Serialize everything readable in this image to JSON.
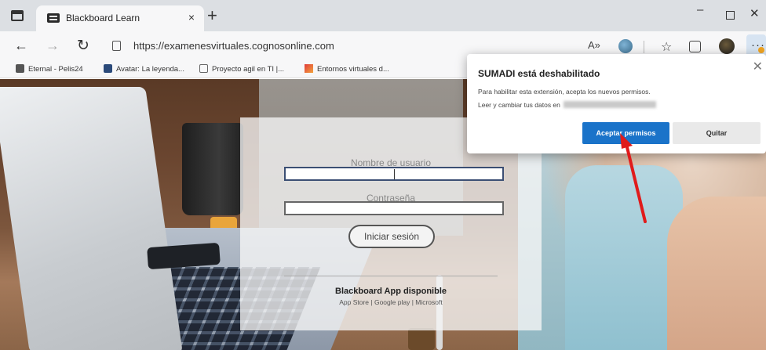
{
  "browser": {
    "tab": {
      "title": "Blackboard Learn",
      "close": "×"
    },
    "new_tab": "+",
    "window_controls": {
      "minimize": "–",
      "close": "✕"
    },
    "nav": {
      "back": "←",
      "forward": "→",
      "reload": "↻"
    },
    "url": "https://examenesvirtuales.cognosonline.com",
    "icons": {
      "read_aloud": "A​",
      "favorites": "☆",
      "more": "···"
    },
    "favorites": [
      {
        "label": "Eternal - Pelis24"
      },
      {
        "label": "Avatar: La leyenda..."
      },
      {
        "label": "Proyecto agil en TI |..."
      },
      {
        "label": "Entornos virtuales d..."
      }
    ]
  },
  "login": {
    "username_label": "Nombre de usuario",
    "password_label": "Contraseña",
    "submit_label": "Iniciar sesión",
    "app_title": "Blackboard App disponible",
    "app_links": "App Store | Google play | Microsoft"
  },
  "extension_popup": {
    "title": "SUMADI está deshabilitado",
    "description": "Para habilitar esta extensión, acepta los nuevos permisos.",
    "permission": "Leer y cambiar tus datos en",
    "accept_label": "Aceptar permisos",
    "remove_label": "Quitar",
    "close": "✕"
  },
  "annotation_color": "#e01b1b"
}
